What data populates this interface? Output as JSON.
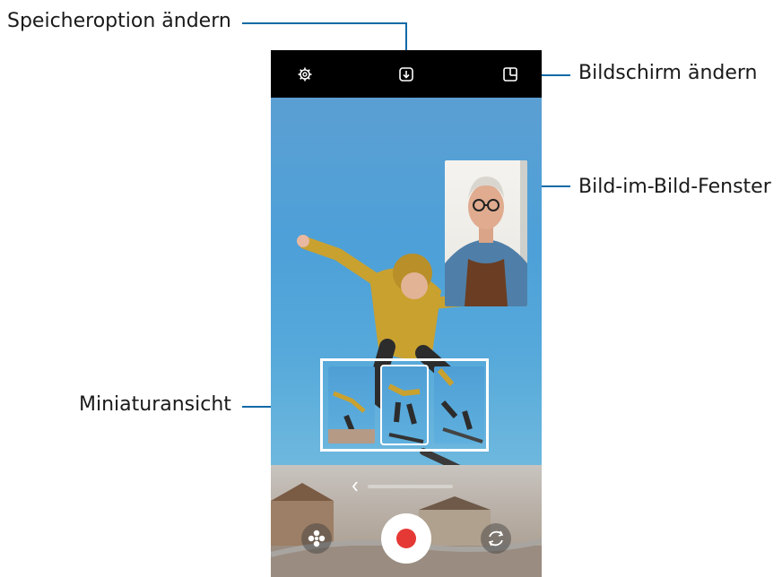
{
  "callouts": {
    "save_option": "Speicheroption ändern",
    "change_screen": "Bildschirm ändern",
    "pip_window": "Bild-im-Bild-Fenster",
    "thumbnail_view": "Miniaturansicht"
  },
  "colors": {
    "callout_line": "#0f6aa6",
    "topbar": "#000000",
    "record": "#e53935"
  },
  "icons": {
    "settings": "gear-icon",
    "save_option": "download-box-icon",
    "change_screen": "layout-icon",
    "back": "chevron-left-icon",
    "effects": "flower-icon",
    "record": "record-button",
    "switch_camera": "camera-switch-icon"
  }
}
